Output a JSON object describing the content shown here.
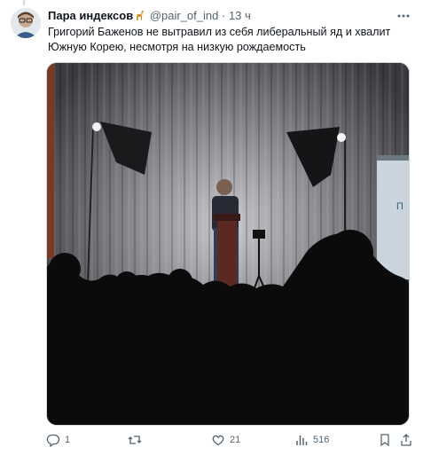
{
  "tweet": {
    "author_name": "Пара индексов",
    "author_emoji": "giraffe-emoji",
    "handle": "@pair_of_ind",
    "separator": "·",
    "time": "13 ч",
    "text": "Григорий Баженов не вытравил из себя либеральный яд и хвалит Южную Корею, несмотря на низкую рождаемость"
  },
  "media": {
    "description_icon": "photo",
    "slide_text": "П"
  },
  "actions": {
    "reply_count": "1",
    "retweet_count": "",
    "like_count": "21",
    "views_count": "516"
  },
  "colors": {
    "text": "#0f1419",
    "secondary": "#536471",
    "border": "#cfd9de"
  }
}
